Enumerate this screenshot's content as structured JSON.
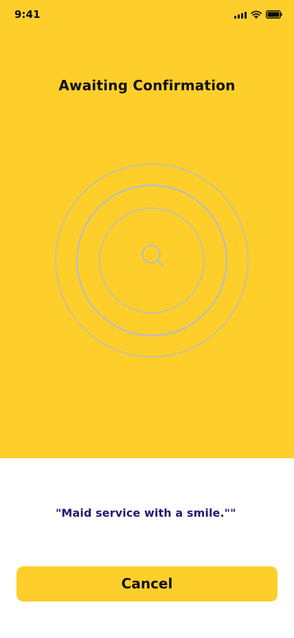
{
  "status_bar": {
    "time": "9:41",
    "icons": [
      "signal-icon",
      "wifi-icon",
      "battery-icon"
    ]
  },
  "screen": {
    "title": "Awaiting Confirmation",
    "quote": "\"Maid service with a smile.\"\"",
    "cancel_label": "Cancel"
  },
  "colors": {
    "primary_yellow": "#FECE2B",
    "text_dark": "#111111",
    "quote_text": "#1f1a72",
    "radar_ring": "#b8bcc8",
    "background": "#ffffff"
  },
  "icons": {
    "center": "search-icon"
  }
}
